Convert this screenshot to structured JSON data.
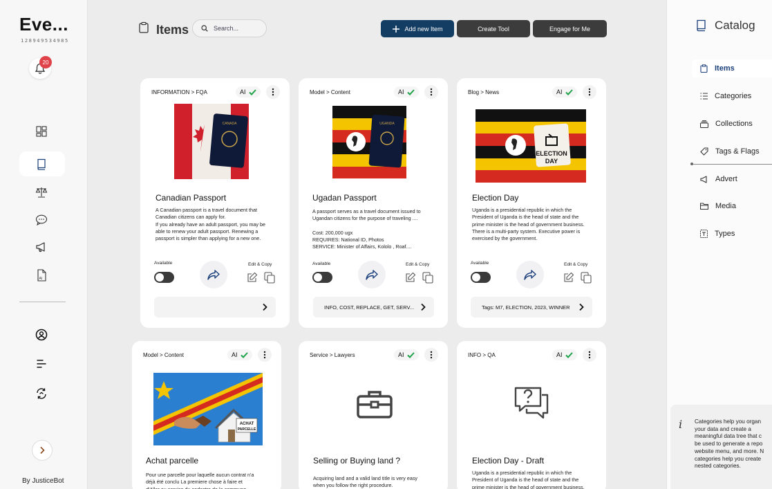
{
  "sidebar": {
    "logo": "Eve...",
    "logo_number": "128949534985",
    "notification_count": "20",
    "byline": "By JusticeBot"
  },
  "header": {
    "title": "Items",
    "search_placeholder": "Search...",
    "add_button": "Add new Item",
    "create_tool_button": "Create Tool",
    "engage_button": "Engage for Me"
  },
  "cards": [
    {
      "breadcrumb": "INFORMATION > FQA",
      "ai": "AI",
      "title": "Canadian Passport",
      "description": "A Canadian passport is a travel document that\nCanadian citizens can apply for.\nIf you already have an adult passport, you may be\nable to renew your adult passport. Renewing a\npassport is simpler than applying for a new one.",
      "available": "Available",
      "edit_copy": "Edit  & Copy",
      "tags": ""
    },
    {
      "breadcrumb": "Model > Content",
      "ai": "AI",
      "title": "Ugadan Passport",
      "description": "A passport serves as a travel document issued to\nUgandan citizens for the purpose of traveling ....\n\nCost: 200,000 ugx\nREQUIRES: National ID, Photos\nSERVICE: Minister of Affairs, Kololo  , Roaf....",
      "available": "Available",
      "edit_copy": "Edit  & Copy",
      "tags": "INFO, COST, REPLACE, GET,  SERV..."
    },
    {
      "breadcrumb": "Blog > News",
      "ai": "AI",
      "title": "Election Day",
      "description": "Uganda is a presidential republic in which the\nPresident of Uganda is the head of state and the\nprime minister is the head of government business.\nThere is a multi-party system. Executive power is\nexercised by the government.",
      "available": "Available",
      "edit_copy": "Edit  & Copy",
      "tags": "Tags: M7, ELECTION, 2023, WINNER"
    },
    {
      "breadcrumb": "Model > Content",
      "ai": "AI",
      "title": "Achat parcelle",
      "description": "Pour une parcelle pour laquelle aucun contrat n'a\ndéjà été conclu La premiere chose à faire et\nd'Aller au service du cadastre de la commune"
    },
    {
      "breadcrumb": "Service > Lawyers",
      "ai": "AI",
      "title": "Selling or Buying land ?",
      "description": "Acquiring land and a valid land title is very easy\nwhen you follow the right procedure."
    },
    {
      "breadcrumb": "INFO > QA",
      "ai": "AI",
      "title": "Election Day - Draft",
      "description": "Uganda is a presidential republic in which the\nPresident of Uganda is the head of state and the\nprime minister is the head of government business."
    }
  ],
  "image_text": {
    "canada_passport": "CANADA",
    "uganda_passport": "UGANDA",
    "election_sign_1": "ELECTION",
    "election_sign_2": "DAY",
    "achat_sign_1": "ACHAT",
    "achat_sign_2": "PARCELLE"
  },
  "catalog": {
    "title": "Catalog",
    "items": [
      {
        "label": "Items"
      },
      {
        "label": "Categories"
      },
      {
        "label": "Collections"
      },
      {
        "label": "Tags & Flags"
      },
      {
        "label": "Advert"
      },
      {
        "label": "Media"
      },
      {
        "label": "Types"
      }
    ],
    "info_text": "Categories help you organ\nyour data and create a\nmeaningful data tree that c\nbe used to generate a repo\nwebsite menu, and more. N\ncategories help you create\nnested categories."
  },
  "colors": {
    "primary": "#143d63",
    "dark_button": "#3c3c3c",
    "badge": "#e0424a",
    "check": "#1fa24a",
    "active_nav": "#1a3e7a"
  }
}
